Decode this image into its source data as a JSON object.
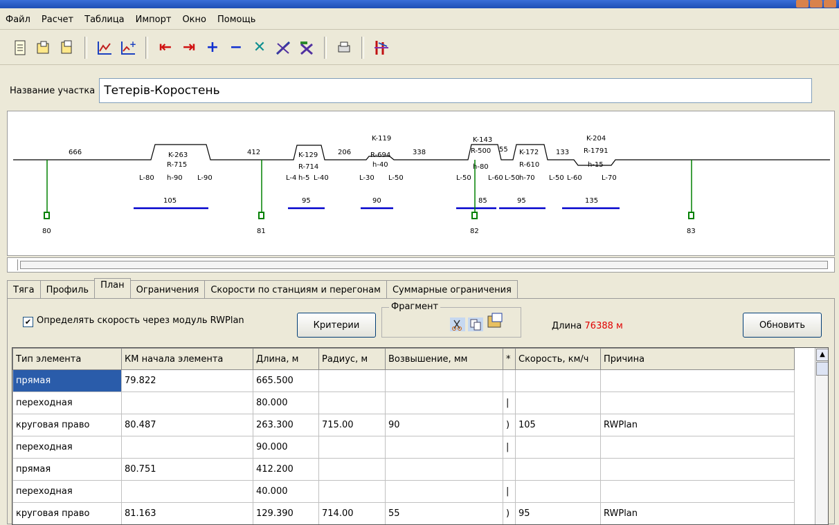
{
  "menu": [
    "Файл",
    "Расчет",
    "Таблица",
    "Импорт",
    "Окно",
    "Помощь"
  ],
  "section": {
    "label": "Название участка",
    "value": "Тетерів-Коростень"
  },
  "diagram": {
    "straights": [
      "666",
      "412",
      "206",
      "338",
      "55",
      "133"
    ],
    "curves": [
      {
        "lines": [
          "K-263",
          "R-715",
          "h-90"
        ]
      },
      {
        "lines": [
          "K-129",
          "R-714",
          "h-5"
        ]
      },
      {
        "lines": [
          "K-119",
          "R-694",
          "h-40"
        ]
      },
      {
        "lines": [
          "K-143",
          "R-500",
          "h-80"
        ]
      },
      {
        "lines": [
          "K-172",
          "R-610",
          "h-70"
        ]
      },
      {
        "lines": [
          "K-204",
          "R-1791",
          "h-15"
        ]
      }
    ],
    "transitions": [
      "L-80",
      "L-90",
      "L-4",
      "L-40",
      "L-30",
      "L-50",
      "L-50",
      "L-60",
      "L-50",
      "L-50",
      "L-60",
      "L-70"
    ],
    "speeds": [
      "105",
      "95",
      "90",
      "85",
      "95",
      "135"
    ],
    "km_posts": [
      "80",
      "81",
      "82",
      "83"
    ],
    "colors": {
      "track": "#000000",
      "speed": "#0000cc",
      "post": "#008000"
    }
  },
  "tabs": [
    "Тяга",
    "Профиль",
    "План",
    "Ограничения",
    "Скорости по станциям и перегонам",
    "Суммарные ограничения"
  ],
  "active_tab": "План",
  "controls": {
    "checkbox_label": "Определять скорость через модуль RWPlan",
    "checkbox_checked": true,
    "criteria_button": "Критерии",
    "fragment_label": "Фрагмент",
    "length_label": "Длина",
    "length_value": "76388 м",
    "refresh_button": "Обновить"
  },
  "table": {
    "columns": [
      "Тип элемента",
      "КМ начала элемента",
      "Длина, м",
      "Радиус, м",
      "Возвышение, мм",
      "*",
      "Скорость, км/ч",
      "Причина"
    ],
    "rows": [
      [
        "прямая",
        "79.822",
        "665.500",
        "",
        "",
        "",
        "",
        ""
      ],
      [
        "переходная",
        "",
        "80.000",
        "",
        "",
        "|",
        "",
        ""
      ],
      [
        "круговая право",
        "80.487",
        "263.300",
        "715.00",
        "90",
        ")",
        "105",
        "RWPlan"
      ],
      [
        "переходная",
        "",
        "90.000",
        "",
        "",
        "|",
        "",
        ""
      ],
      [
        "прямая",
        "80.751",
        "412.200",
        "",
        "",
        "",
        "",
        ""
      ],
      [
        "переходная",
        "",
        "40.000",
        "",
        "",
        "|",
        "",
        ""
      ],
      [
        "круговая право",
        "81.163",
        "129.390",
        "714.00",
        "55",
        ")",
        "95",
        "RWPlan"
      ]
    ]
  }
}
